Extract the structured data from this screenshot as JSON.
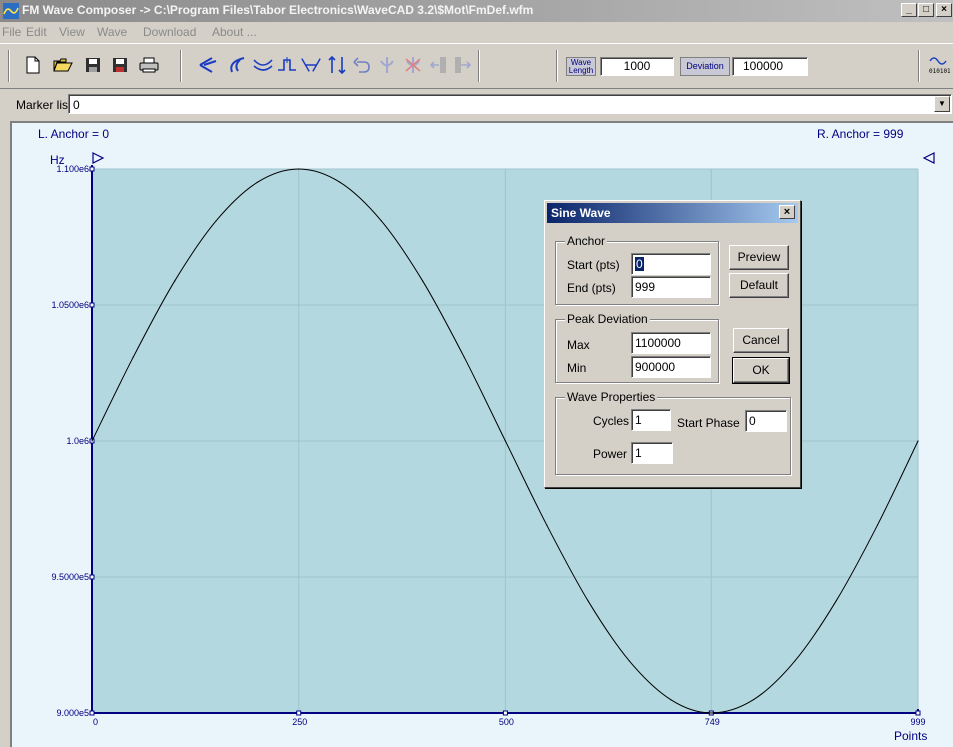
{
  "window": {
    "title": "FM Wave Composer -> C:\\Program Files\\Tabor Electronics\\WaveCAD 3.2\\$Mot\\FmDef.wfm",
    "minimize": "_",
    "restore": "□",
    "close": "×"
  },
  "menu": [
    "File",
    "Edit",
    "View",
    "Wave",
    "Download",
    "About ..."
  ],
  "toolbar": {
    "wave_length_label_1": "Wave",
    "wave_length_label_2": "Length",
    "wave_length_value": "1000",
    "deviation_label": "Deviation",
    "deviation_value": "100000"
  },
  "marker_list": {
    "label": "Marker list",
    "value": "0"
  },
  "plot": {
    "left_anchor": "L. Anchor = 0",
    "right_anchor": "R. Anchor = 999",
    "y_unit": "Hz",
    "x_unit": "Points",
    "colors": {
      "plot_bg": "#b3d8df",
      "curve": "#000000",
      "axis": "#000080"
    }
  },
  "chart_data": {
    "type": "line",
    "xlabel": "Points",
    "ylabel": "Hz",
    "xlim": [
      0,
      999
    ],
    "ylim": [
      900000,
      1100000
    ],
    "x_ticks": [
      "0",
      "250",
      "500",
      "749",
      "999"
    ],
    "x_tick_values": [
      0,
      250,
      500,
      749,
      999
    ],
    "y_ticks": [
      "1.100e6",
      "1.0500e6",
      "1.0e6",
      "9.5000e5",
      "9.000e5"
    ],
    "y_tick_values": [
      1100000,
      1050000,
      1000000,
      950000,
      900000
    ],
    "series": [
      {
        "x": [
          0,
          50,
          100,
          150,
          200,
          250,
          300,
          350,
          400,
          450,
          500,
          550,
          600,
          650,
          700,
          749,
          800,
          850,
          900,
          950,
          999
        ],
        "y": [
          1000000,
          1030900,
          1058800,
          1080900,
          1095100,
          1100000,
          1095100,
          1080900,
          1058800,
          1030900,
          1000000,
          969100,
          941200,
          919100,
          904900,
          900000,
          904900,
          919100,
          941200,
          969100,
          1000000
        ]
      }
    ],
    "grid": true
  },
  "dialog": {
    "title": "Sine Wave",
    "close": "×",
    "anchor_group": "Anchor",
    "start_label": "Start (pts)",
    "start_value": "0",
    "end_label": "End  (pts)",
    "end_value": "999",
    "peak_group": "Peak Deviation",
    "max_label": "Max",
    "max_value": "1100000",
    "min_label": "Min",
    "min_value": "900000",
    "wave_group": "Wave Properties",
    "cycles_label": "Cycles",
    "cycles_value": "1",
    "start_phase_label": "Start Phase",
    "start_phase_value": "0",
    "power_label": "Power",
    "power_value": "1",
    "preview": "Preview",
    "default": "Default",
    "cancel": "Cancel",
    "ok": "OK"
  }
}
